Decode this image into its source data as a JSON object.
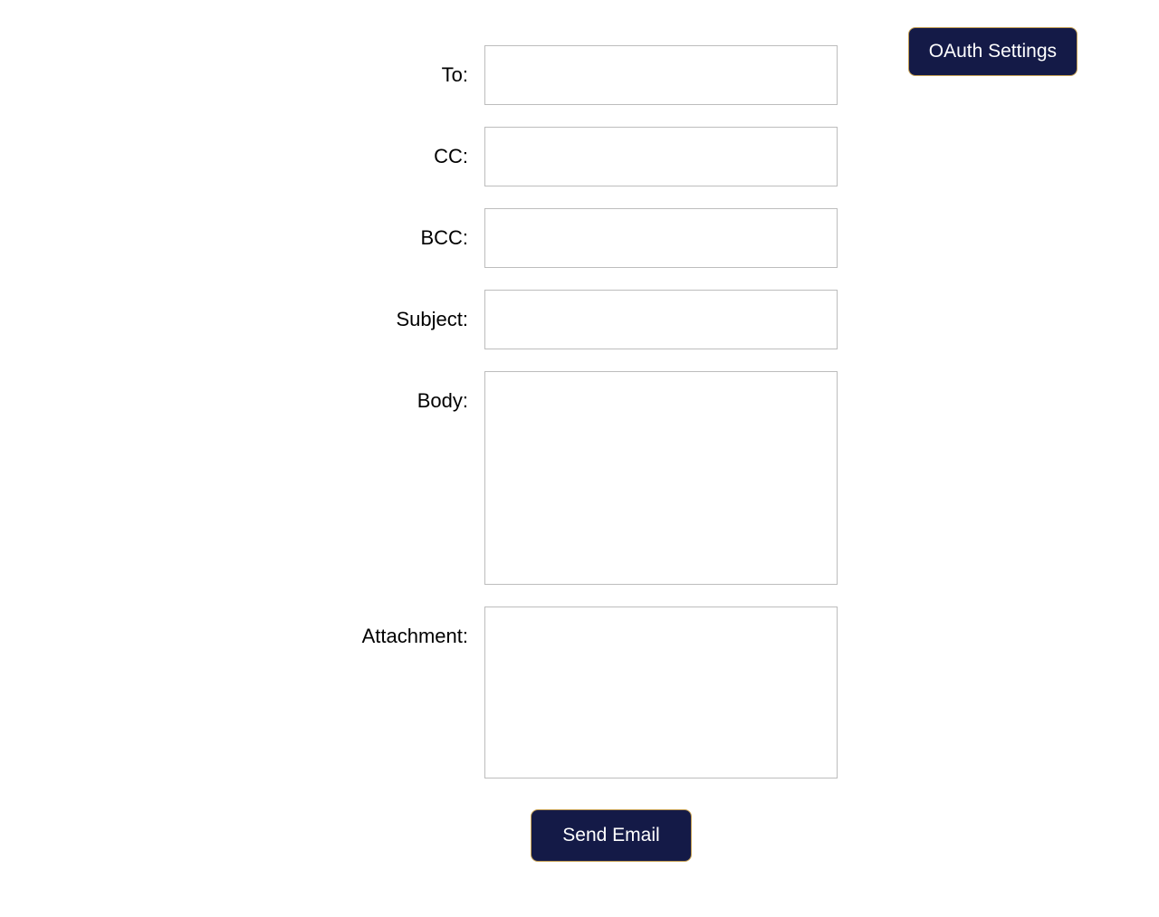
{
  "header": {
    "oauth_button_label": "OAuth Settings"
  },
  "form": {
    "to": {
      "label": "To:",
      "value": ""
    },
    "cc": {
      "label": "CC:",
      "value": ""
    },
    "bcc": {
      "label": "BCC:",
      "value": ""
    },
    "subject": {
      "label": "Subject:",
      "value": ""
    },
    "body": {
      "label": "Body:",
      "value": ""
    },
    "attachment": {
      "label": "Attachment:"
    },
    "send_button_label": "Send Email"
  },
  "colors": {
    "button_bg": "#141a47",
    "button_border": "#c5a054",
    "input_border": "#bdbdbd"
  }
}
